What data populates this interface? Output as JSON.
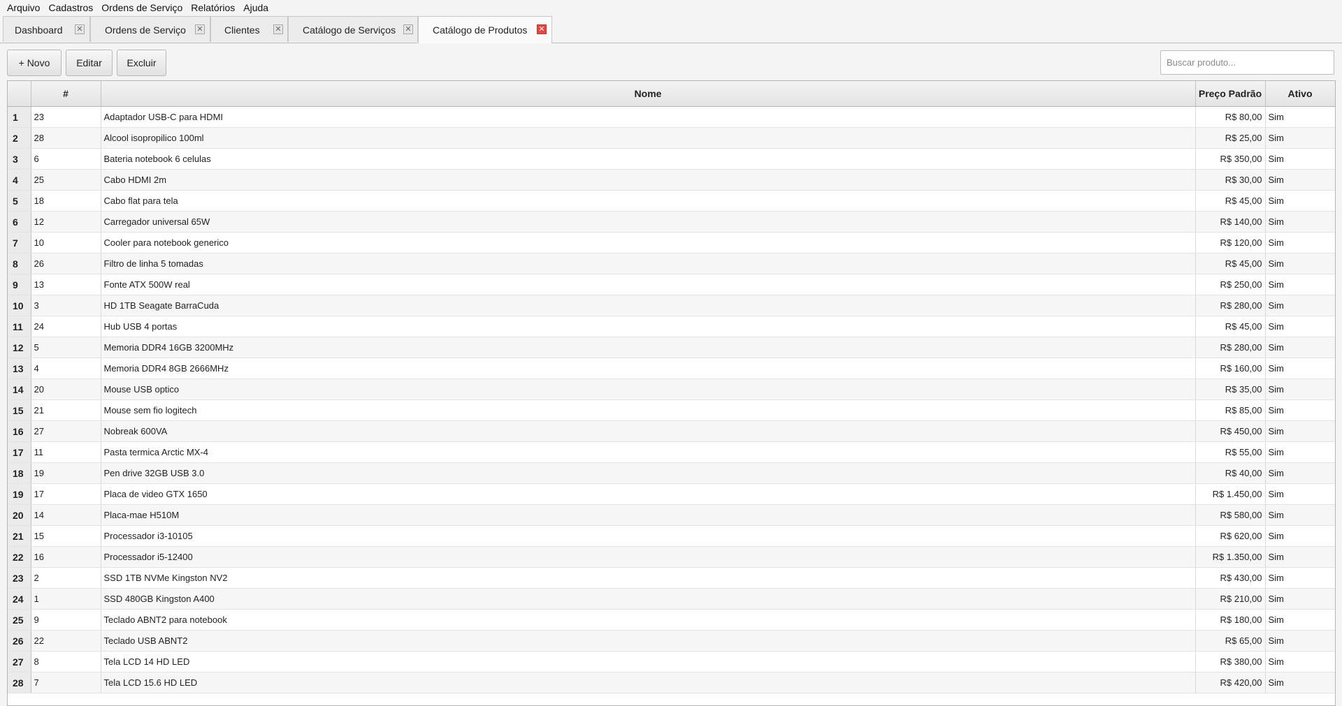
{
  "menu": [
    "Arquivo",
    "Cadastros",
    "Ordens de Serviço",
    "Relatórios",
    "Ajuda"
  ],
  "tabs": [
    {
      "label": "Dashboard",
      "active": false
    },
    {
      "label": "Ordens de Serviço",
      "active": false
    },
    {
      "label": "Clientes",
      "active": false
    },
    {
      "label": "Catálogo de Serviços",
      "active": false
    },
    {
      "label": "Catálogo de Produtos",
      "active": true
    }
  ],
  "toolbar": {
    "new_label": "+ Novo",
    "edit_label": "Editar",
    "delete_label": "Excluir"
  },
  "search": {
    "placeholder": "Buscar produto..."
  },
  "table": {
    "headers": {
      "row": "",
      "id": "#",
      "name": "Nome",
      "price": "Preço Padrão",
      "active": "Ativo"
    },
    "rows": [
      {
        "n": "1",
        "id": "23",
        "name": "Adaptador USB-C para HDMI",
        "price": "R$ 80,00",
        "active": "Sim"
      },
      {
        "n": "2",
        "id": "28",
        "name": "Alcool isopropilico 100ml",
        "price": "R$ 25,00",
        "active": "Sim"
      },
      {
        "n": "3",
        "id": "6",
        "name": "Bateria notebook 6 celulas",
        "price": "R$ 350,00",
        "active": "Sim"
      },
      {
        "n": "4",
        "id": "25",
        "name": "Cabo HDMI 2m",
        "price": "R$ 30,00",
        "active": "Sim"
      },
      {
        "n": "5",
        "id": "18",
        "name": "Cabo flat para tela",
        "price": "R$ 45,00",
        "active": "Sim"
      },
      {
        "n": "6",
        "id": "12",
        "name": "Carregador universal 65W",
        "price": "R$ 140,00",
        "active": "Sim"
      },
      {
        "n": "7",
        "id": "10",
        "name": "Cooler para notebook generico",
        "price": "R$ 120,00",
        "active": "Sim"
      },
      {
        "n": "8",
        "id": "26",
        "name": "Filtro de linha 5 tomadas",
        "price": "R$ 45,00",
        "active": "Sim"
      },
      {
        "n": "9",
        "id": "13",
        "name": "Fonte ATX 500W real",
        "price": "R$ 250,00",
        "active": "Sim"
      },
      {
        "n": "10",
        "id": "3",
        "name": "HD 1TB Seagate BarraCuda",
        "price": "R$ 280,00",
        "active": "Sim"
      },
      {
        "n": "11",
        "id": "24",
        "name": "Hub USB 4 portas",
        "price": "R$ 45,00",
        "active": "Sim"
      },
      {
        "n": "12",
        "id": "5",
        "name": "Memoria DDR4 16GB 3200MHz",
        "price": "R$ 280,00",
        "active": "Sim"
      },
      {
        "n": "13",
        "id": "4",
        "name": "Memoria DDR4 8GB 2666MHz",
        "price": "R$ 160,00",
        "active": "Sim"
      },
      {
        "n": "14",
        "id": "20",
        "name": "Mouse USB optico",
        "price": "R$ 35,00",
        "active": "Sim"
      },
      {
        "n": "15",
        "id": "21",
        "name": "Mouse sem fio logitech",
        "price": "R$ 85,00",
        "active": "Sim"
      },
      {
        "n": "16",
        "id": "27",
        "name": "Nobreak 600VA",
        "price": "R$ 450,00",
        "active": "Sim"
      },
      {
        "n": "17",
        "id": "11",
        "name": "Pasta termica Arctic MX-4",
        "price": "R$ 55,00",
        "active": "Sim"
      },
      {
        "n": "18",
        "id": "19",
        "name": "Pen drive 32GB USB 3.0",
        "price": "R$ 40,00",
        "active": "Sim"
      },
      {
        "n": "19",
        "id": "17",
        "name": "Placa de video GTX 1650",
        "price": "R$ 1.450,00",
        "active": "Sim"
      },
      {
        "n": "20",
        "id": "14",
        "name": "Placa-mae H510M",
        "price": "R$ 580,00",
        "active": "Sim"
      },
      {
        "n": "21",
        "id": "15",
        "name": "Processador i3-10105",
        "price": "R$ 620,00",
        "active": "Sim"
      },
      {
        "n": "22",
        "id": "16",
        "name": "Processador i5-12400",
        "price": "R$ 1.350,00",
        "active": "Sim"
      },
      {
        "n": "23",
        "id": "2",
        "name": "SSD 1TB NVMe Kingston NV2",
        "price": "R$ 430,00",
        "active": "Sim"
      },
      {
        "n": "24",
        "id": "1",
        "name": "SSD 480GB Kingston A400",
        "price": "R$ 210,00",
        "active": "Sim"
      },
      {
        "n": "25",
        "id": "9",
        "name": "Teclado ABNT2 para notebook",
        "price": "R$ 180,00",
        "active": "Sim"
      },
      {
        "n": "26",
        "id": "22",
        "name": "Teclado USB ABNT2",
        "price": "R$ 65,00",
        "active": "Sim"
      },
      {
        "n": "27",
        "id": "8",
        "name": "Tela LCD 14 HD LED",
        "price": "R$ 380,00",
        "active": "Sim"
      },
      {
        "n": "28",
        "id": "7",
        "name": "Tela LCD 15.6 HD LED",
        "price": "R$ 420,00",
        "active": "Sim"
      }
    ]
  }
}
